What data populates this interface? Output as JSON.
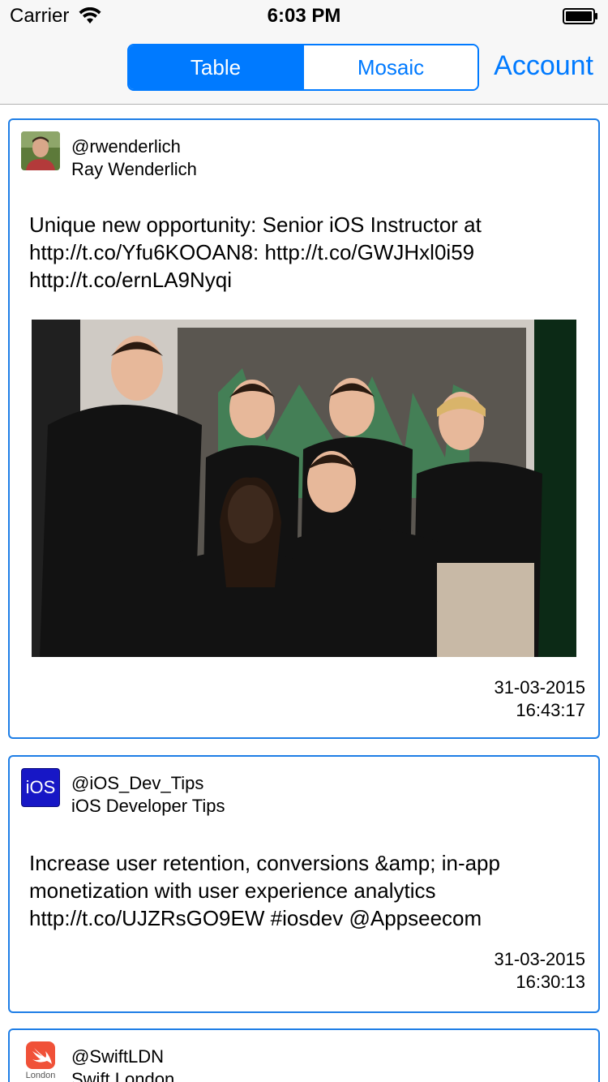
{
  "status_bar": {
    "carrier": "Carrier",
    "time": "6:03 PM"
  },
  "nav": {
    "segments": [
      "Table",
      "Mosaic"
    ],
    "selected_segment": "Table",
    "account_label": "Account"
  },
  "colors": {
    "accent": "#007aff",
    "card_border": "#1e7ee6"
  },
  "tweets": [
    {
      "handle": "@rwenderlich",
      "name": "Ray Wenderlich",
      "text": "Unique new opportunity: Senior iOS Instructor at http://t.co/Yfu6KOOAN8: http://t.co/GWJHxl0i59 http://t.co/ernLA9Nyqi",
      "date": "31-03-2015",
      "time": "16:43:17",
      "avatar_icon": "person-avatar",
      "has_photo": true
    },
    {
      "handle": "@iOS_Dev_Tips",
      "name": "iOS Developer Tips",
      "avatar_label": "iOS",
      "text": "Increase user retention, conversions &amp; in-app monetization with user experience analytics http://t.co/UJZRsGO9EW #iosdev @Appseecom",
      "date": "31-03-2015",
      "time": "16:30:13",
      "has_photo": false
    },
    {
      "handle": "@SwiftLDN",
      "name": "Swift London",
      "avatar_label": "London",
      "avatar_icon": "swift-icon"
    }
  ]
}
